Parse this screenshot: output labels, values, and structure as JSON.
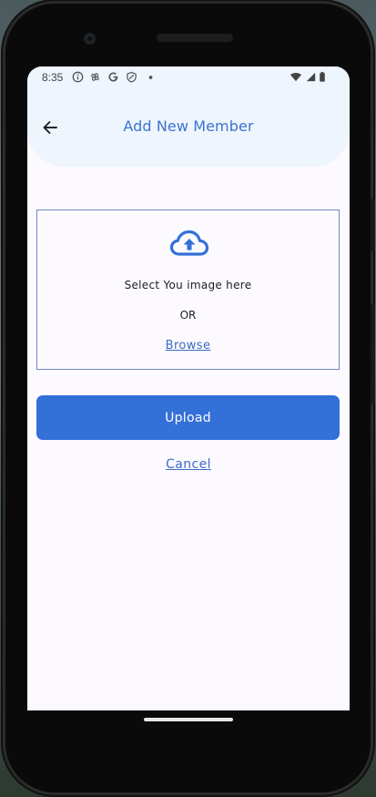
{
  "status_bar": {
    "time": "8:35",
    "left_icons": [
      "info-icon",
      "pinwheel-icon",
      "google-icon",
      "shield-icon",
      "dot-icon"
    ],
    "right_icons": [
      "wifi-icon",
      "signal-icon",
      "battery-icon"
    ]
  },
  "header": {
    "back_icon": "arrow-left-icon",
    "title": "Add New Member"
  },
  "upload_area": {
    "icon": "cloud-upload-icon",
    "select_text": "Select You image here",
    "or_text": "OR",
    "browse_label": "Browse"
  },
  "actions": {
    "upload_label": "Upload",
    "cancel_label": "Cancel"
  },
  "colors": {
    "accent": "#3370d7",
    "title": "#3b74d0",
    "header_bg": "#eef5fd",
    "screen_bg": "#fcfaff",
    "drop_border": "#6e89c6"
  }
}
